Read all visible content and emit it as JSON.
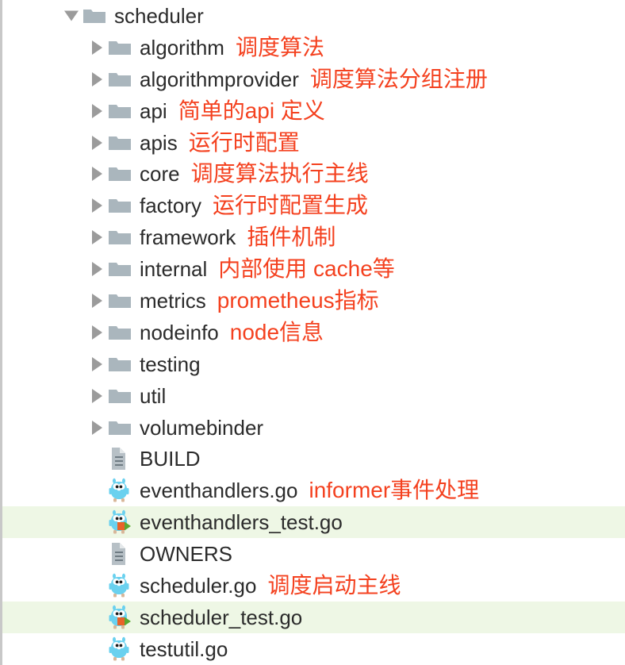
{
  "colors": {
    "folder_icon": "#aab6bd",
    "file_icon": "#b0bac0",
    "gopher_body": "#6ad1ef",
    "label_text": "#2b2b2b",
    "annotation_text": "#f4411f",
    "row_highlight": "#eef7e5",
    "twisty": "#9b9b9b",
    "left_border": "#c8c8c8"
  },
  "tree": {
    "rows": [
      {
        "label": "scheduler",
        "note": "",
        "icon": "folder-icon",
        "twisty": "down",
        "indent": 78,
        "highlight": false
      },
      {
        "label": "algorithm",
        "note": "调度算法",
        "icon": "folder-icon",
        "twisty": "right",
        "indent": 110,
        "highlight": false
      },
      {
        "label": "algorithmprovider",
        "note": "调度算法分组注册",
        "icon": "folder-icon",
        "twisty": "right",
        "indent": 110,
        "highlight": false
      },
      {
        "label": "api",
        "note": "简单的api 定义",
        "icon": "folder-icon",
        "twisty": "right",
        "indent": 110,
        "highlight": false
      },
      {
        "label": "apis",
        "note": "运行时配置",
        "icon": "folder-icon",
        "twisty": "right",
        "indent": 110,
        "highlight": false
      },
      {
        "label": "core",
        "note": "调度算法执行主线",
        "icon": "folder-icon",
        "twisty": "right",
        "indent": 110,
        "highlight": false
      },
      {
        "label": "factory",
        "note": "运行时配置生成",
        "icon": "folder-icon",
        "twisty": "right",
        "indent": 110,
        "highlight": false
      },
      {
        "label": "framework",
        "note": "插件机制",
        "icon": "folder-icon",
        "twisty": "right",
        "indent": 110,
        "highlight": false
      },
      {
        "label": "internal",
        "note": "内部使用 cache等",
        "icon": "folder-icon",
        "twisty": "right",
        "indent": 110,
        "highlight": false
      },
      {
        "label": "metrics",
        "note": "prometheus指标",
        "icon": "folder-icon",
        "twisty": "right",
        "indent": 110,
        "highlight": false
      },
      {
        "label": "nodeinfo",
        "note": "node信息",
        "icon": "folder-icon",
        "twisty": "right",
        "indent": 110,
        "highlight": false
      },
      {
        "label": "testing",
        "note": "",
        "icon": "folder-icon",
        "twisty": "right",
        "indent": 110,
        "highlight": false
      },
      {
        "label": "util",
        "note": "",
        "icon": "folder-icon",
        "twisty": "right",
        "indent": 110,
        "highlight": false
      },
      {
        "label": "volumebinder",
        "note": "",
        "icon": "folder-icon",
        "twisty": "right",
        "indent": 110,
        "highlight": false
      },
      {
        "label": "BUILD",
        "note": "",
        "icon": "document-icon",
        "twisty": "none",
        "indent": 110,
        "highlight": false
      },
      {
        "label": "eventhandlers.go",
        "note": "informer事件处理",
        "icon": "go-file-icon",
        "twisty": "none",
        "indent": 110,
        "highlight": false
      },
      {
        "label": "eventhandlers_test.go",
        "note": "",
        "icon": "go-test-file-icon",
        "twisty": "none",
        "indent": 110,
        "highlight": true
      },
      {
        "label": "OWNERS",
        "note": "",
        "icon": "document-icon",
        "twisty": "none",
        "indent": 110,
        "highlight": false
      },
      {
        "label": "scheduler.go",
        "note": "调度启动主线",
        "icon": "go-file-icon",
        "twisty": "none",
        "indent": 110,
        "highlight": false
      },
      {
        "label": "scheduler_test.go",
        "note": "",
        "icon": "go-test-file-icon",
        "twisty": "none",
        "indent": 110,
        "highlight": true
      },
      {
        "label": "testutil.go",
        "note": "",
        "icon": "go-file-icon",
        "twisty": "none",
        "indent": 110,
        "highlight": false
      }
    ]
  }
}
